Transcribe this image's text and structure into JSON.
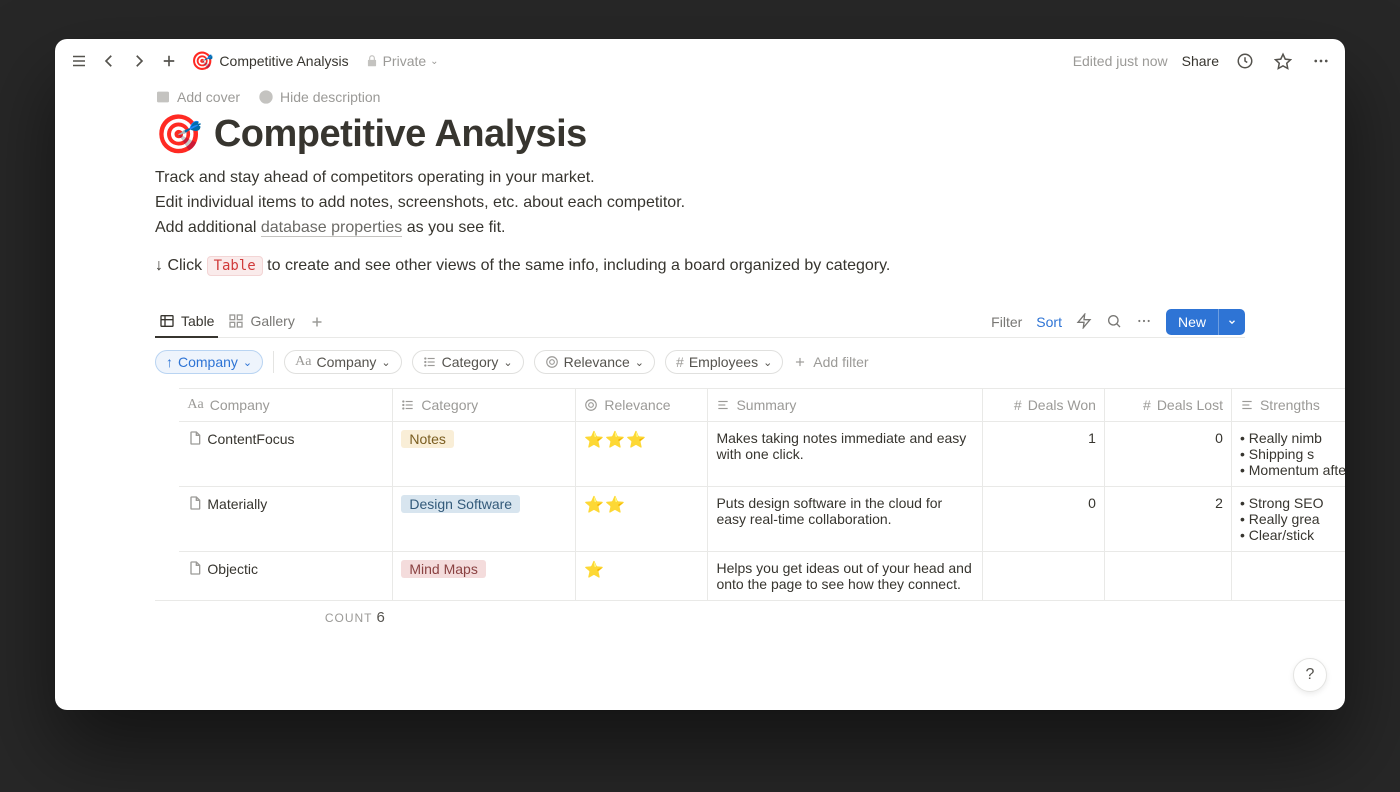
{
  "topbar": {
    "breadcrumb_title": "Competitive Analysis",
    "privacy_label": "Private",
    "edited_label": "Edited just now",
    "share_label": "Share"
  },
  "page_actions": {
    "add_cover": "Add cover",
    "hide_description": "Hide description"
  },
  "page": {
    "emoji": "🎯",
    "title": "Competitive Analysis",
    "desc_line1": "Track and stay ahead of competitors operating in your market.",
    "desc_line2": "Edit individual items to add notes, screenshots, etc. about each competitor.",
    "desc_line3a": "Add additional ",
    "desc_db_link": "database properties",
    "desc_line3b": " as you see fit.",
    "desc_line4a": "↓ Click ",
    "desc_code": "Table",
    "desc_line4b": " to create and see other views of the same info, including a board organized by category."
  },
  "views": {
    "tabs": [
      {
        "label": "Table",
        "icon": "table",
        "active": true
      },
      {
        "label": "Gallery",
        "icon": "gallery",
        "active": false
      }
    ],
    "filter_label": "Filter",
    "sort_label": "Sort",
    "new_label": "New"
  },
  "filters": {
    "sort_chip": {
      "label": "Company",
      "arrow": "↑"
    },
    "chips": [
      {
        "icon": "Aa",
        "label": "Company"
      },
      {
        "icon": "list",
        "label": "Category"
      },
      {
        "icon": "target",
        "label": "Relevance"
      },
      {
        "icon": "hash",
        "label": "Employees"
      }
    ],
    "add_filter": "Add filter"
  },
  "columns": {
    "company": {
      "label": "Company",
      "icon": "Aa"
    },
    "category": {
      "label": "Category",
      "icon": "list"
    },
    "relevance": {
      "label": "Relevance",
      "icon": "target"
    },
    "summary": {
      "label": "Summary",
      "icon": "lines"
    },
    "deals_won": {
      "label": "Deals Won",
      "icon": "hash"
    },
    "deals_lost": {
      "label": "Deals Lost",
      "icon": "hash"
    },
    "strengths": {
      "label": "Strengths",
      "icon": "lines"
    }
  },
  "rows": [
    {
      "company": "ContentFocus",
      "category": {
        "label": "Notes",
        "class": "notes"
      },
      "relevance": "⭐⭐⭐",
      "summary": "Makes taking notes immediate and easy with one click.",
      "deals_won": "1",
      "deals_lost": "0",
      "strengths": [
        "Really nimb",
        "Shipping s",
        "Momentum after funding"
      ]
    },
    {
      "company": "Materially",
      "category": {
        "label": "Design Software",
        "class": "design"
      },
      "relevance": "⭐⭐",
      "summary": "Puts design software in the cloud for easy real-time collaboration.",
      "deals_won": "0",
      "deals_lost": "2",
      "strengths": [
        "Strong SEO",
        "Really grea",
        "Clear/stick"
      ]
    },
    {
      "company": "Objectic",
      "category": {
        "label": "Mind Maps",
        "class": "mind"
      },
      "relevance": "⭐",
      "summary": "Helps you get ideas out of your head and onto the page to see how they connect.",
      "deals_won": "",
      "deals_lost": "",
      "strengths": []
    }
  ],
  "count": {
    "label": "COUNT",
    "value": "6"
  },
  "help": "?"
}
